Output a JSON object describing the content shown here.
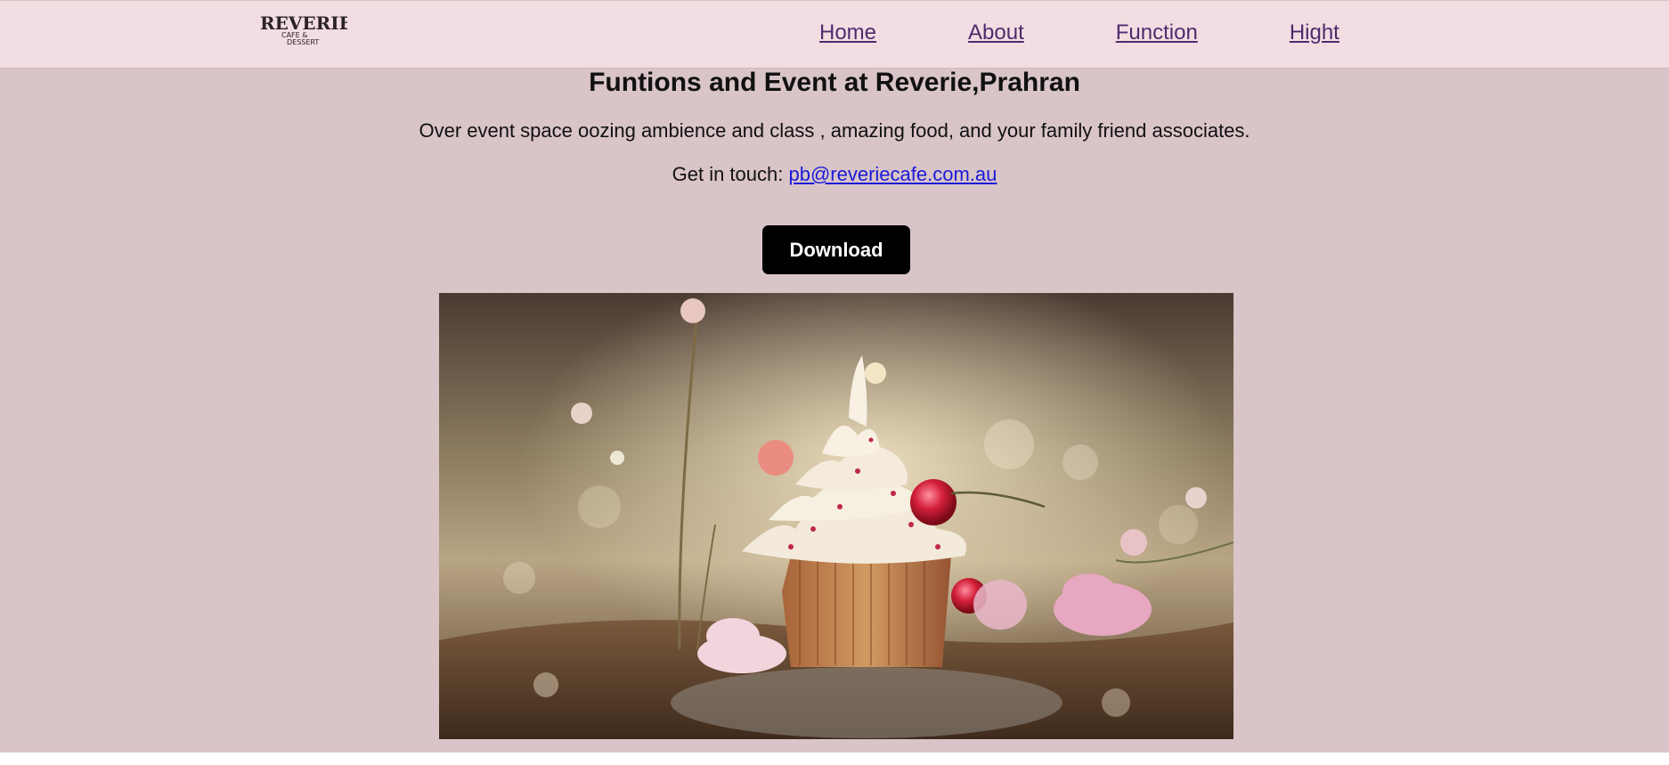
{
  "header": {
    "logo": {
      "text_main": "REVERIE",
      "text_sub1": "CAFE &",
      "text_sub2": "DESSERT"
    },
    "nav": [
      {
        "label": "Home"
      },
      {
        "label": "About"
      },
      {
        "label": "Function"
      },
      {
        "label": "Hight"
      }
    ]
  },
  "main": {
    "title": "Funtions and Event at Reverie,Prahran",
    "description": "Over event space oozing ambience and class , amazing food, and your family friend associates.",
    "contact_prefix": "Get in touch: ",
    "contact_email": "pb@reveriecafe.com.au",
    "download_label": "Download",
    "hero_image": "cupcake-with-flowers-photo"
  },
  "colors": {
    "page_bg": "#d9c4c8",
    "nav_bg": "#f2dde2",
    "nav_link": "#4f2b6e",
    "email_link": "#1a1ad8",
    "button_bg": "#000000",
    "button_text": "#ffffff"
  }
}
